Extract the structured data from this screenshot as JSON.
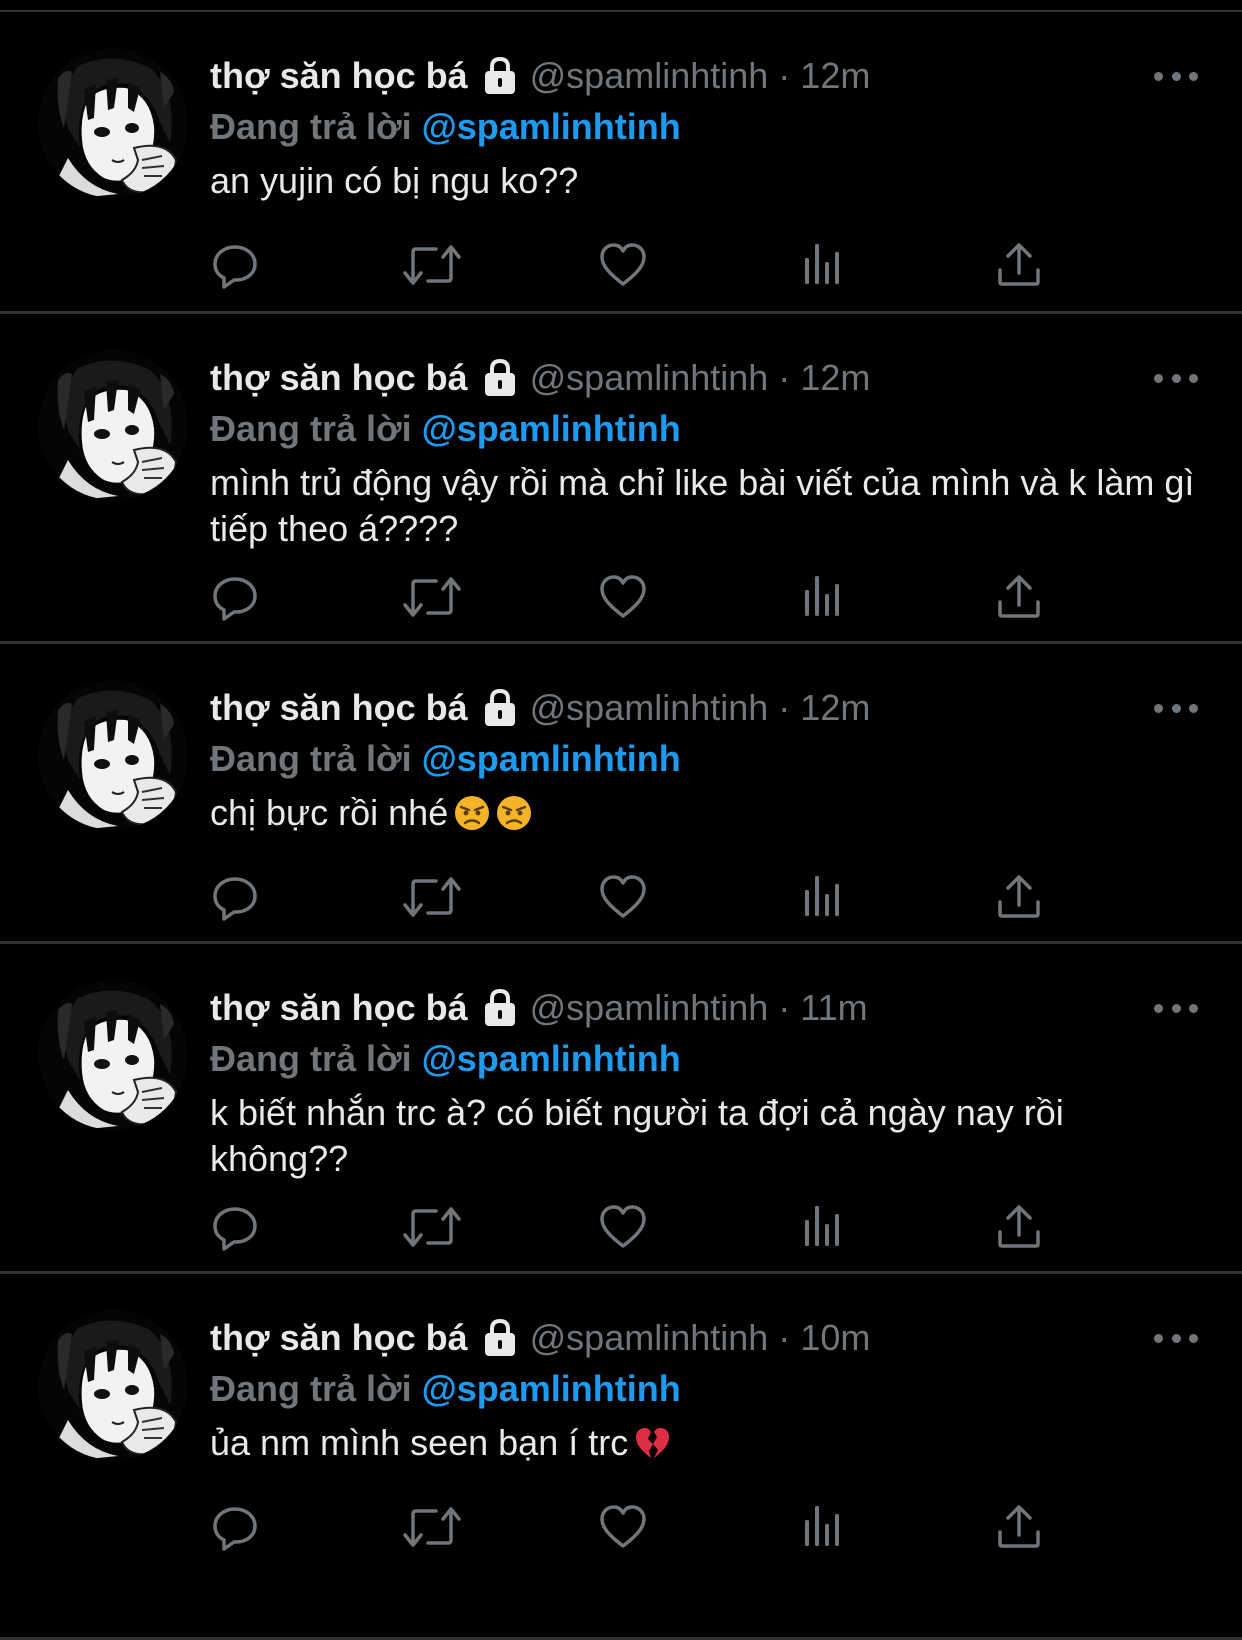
{
  "colors": {
    "background": "#000000",
    "text": "#e7e9ea",
    "muted": "#71767b",
    "link": "#1d9bf0",
    "divider": "#2f3336"
  },
  "tweets": [
    {
      "name": "thợ săn học bá",
      "handle": "@spamlinhtinh",
      "separator": "·",
      "time": "12m",
      "reply_prefix": "Đang trả lời",
      "reply_handle": "@spamlinhtinh",
      "text": "an yujin có bị ngu ko??",
      "emojis": []
    },
    {
      "name": "thợ săn học bá",
      "handle": "@spamlinhtinh",
      "separator": "·",
      "time": "12m",
      "reply_prefix": "Đang trả lời",
      "reply_handle": "@spamlinhtinh",
      "text": "mình trủ động vậy rồi mà chỉ like bài viết của mình và k làm gì tiếp theo á????",
      "emojis": []
    },
    {
      "name": "thợ săn học bá",
      "handle": "@spamlinhtinh",
      "separator": "·",
      "time": "12m",
      "reply_prefix": "Đang trả lời",
      "reply_handle": "@spamlinhtinh",
      "text": "chị bực rồi nhé",
      "emojis": [
        "angry-face-emoji",
        "angry-face-emoji"
      ]
    },
    {
      "name": "thợ săn học bá",
      "handle": "@spamlinhtinh",
      "separator": "·",
      "time": "11m",
      "reply_prefix": "Đang trả lời",
      "reply_handle": "@spamlinhtinh",
      "text": "k biết nhắn trc à? có biết người ta đợi cả ngày nay rồi không??",
      "emojis": []
    },
    {
      "name": "thợ săn học bá",
      "handle": "@spamlinhtinh",
      "separator": "·",
      "time": "10m",
      "reply_prefix": "Đang trả lời",
      "reply_handle": "@spamlinhtinh",
      "text": "ủa nm mình seen bạn í trc",
      "emojis": [
        "broken-heart-emoji"
      ]
    }
  ],
  "icons": {
    "avatar": "anime-girl-avatar",
    "lock": "lock-icon",
    "more": "more-options-icon",
    "actions": [
      "reply-icon",
      "retweet-icon",
      "like-icon",
      "views-icon",
      "share-icon"
    ]
  }
}
